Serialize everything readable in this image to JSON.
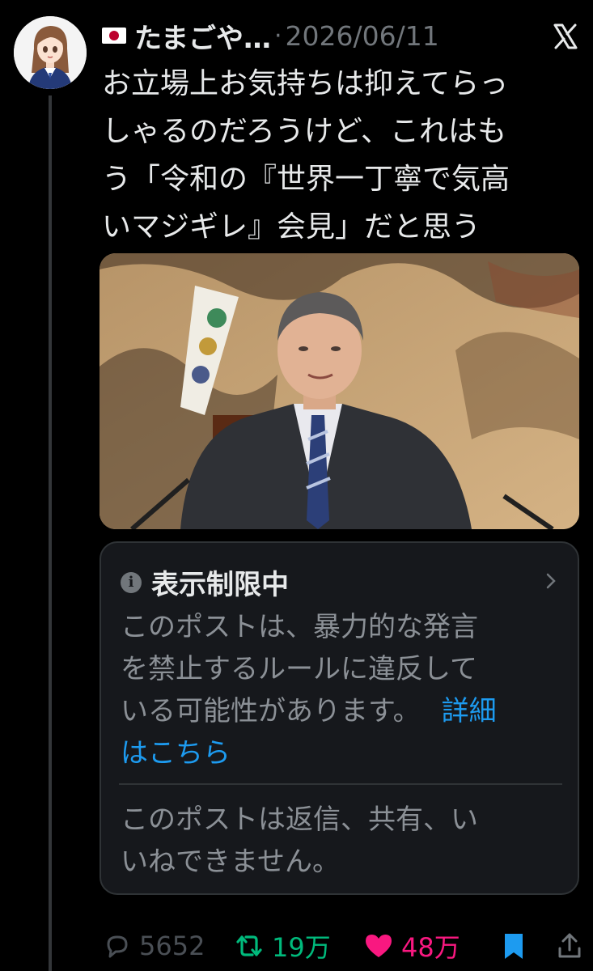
{
  "tweet": {
    "author_name": "たまごや…",
    "separator": "·",
    "date": "2026/06/11",
    "text_lines": [
      "お立場上お気持ちは抑えてらっ",
      "しゃるのだろうけど、これはも",
      "う「令和の『世界一丁寧で気高",
      "いマジギレ』会見」だと思う"
    ]
  },
  "notice": {
    "title": "表示制限中",
    "body_line1": "このポストは、暴力的な発言",
    "body_line2": "を禁止するルールに違反して",
    "body_line3": "いる可能性があります。",
    "link_part1": "詳細",
    "link_part2": "はこちら",
    "footer_line1": "このポストは返信、共有、い",
    "footer_line2": "いねできません。"
  },
  "actions": {
    "reply_count": "5652",
    "repost_count": "19万",
    "like_count": "48万"
  },
  "icons": {
    "brand": "x-logo-icon",
    "flag": "japan-flag-icon",
    "info": "info-icon",
    "chevron": "chevron-right-icon",
    "reply": "reply-icon",
    "repost": "repost-icon",
    "like": "heart-icon",
    "bookmark": "bookmark-icon",
    "share": "share-icon"
  },
  "colors": {
    "background": "#000000",
    "text": "#e7e9ea",
    "muted": "#71767b",
    "link": "#1d9bf0",
    "repost": "#00ba7c",
    "like": "#f91880",
    "bookmark": "#1d9bf0"
  }
}
